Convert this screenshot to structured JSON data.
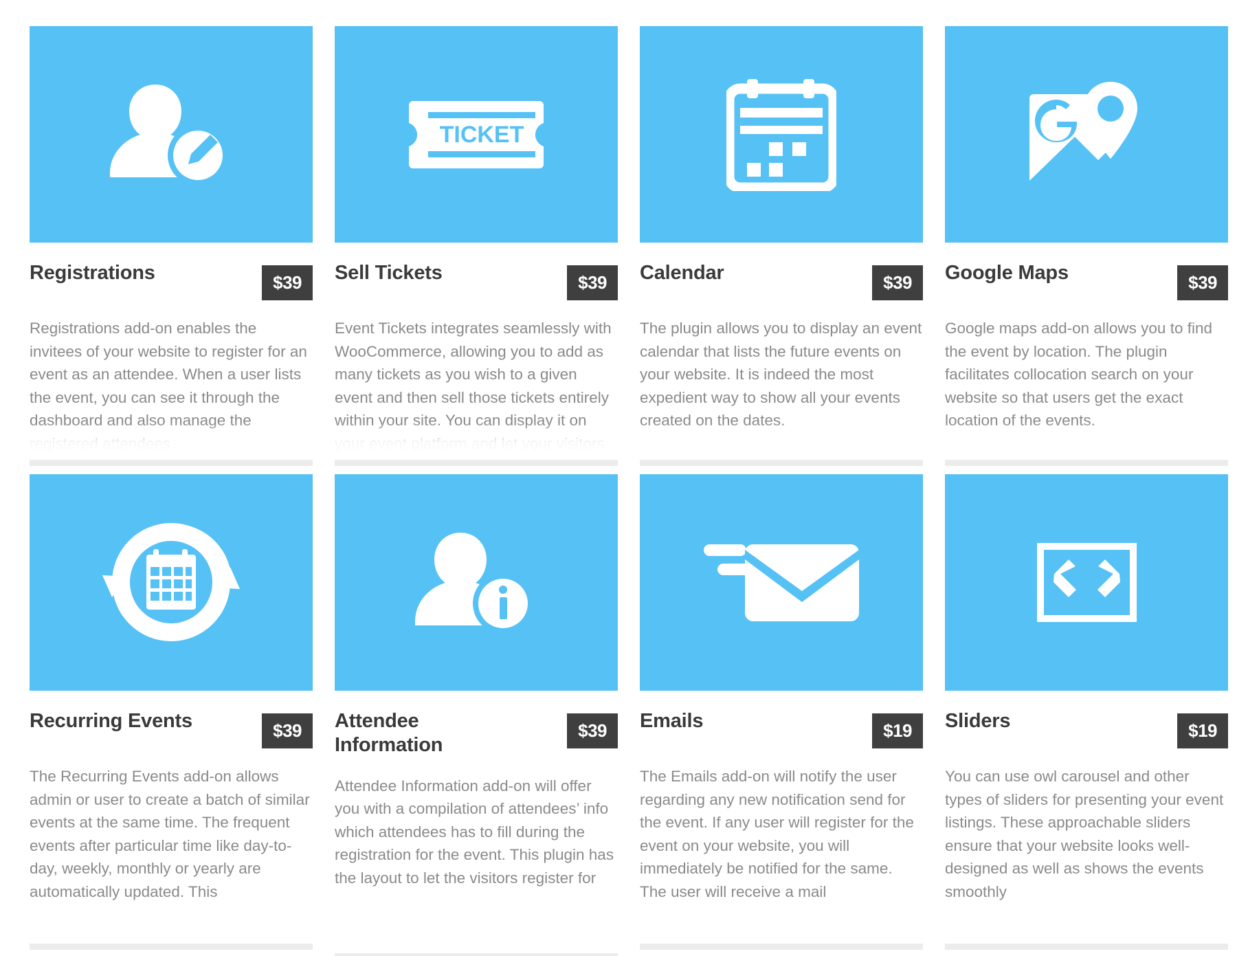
{
  "theme": {
    "accent": "#55c1f5",
    "badge_bg": "#3f3f3f",
    "badge_text": "#ffffff",
    "title_color": "#3a3a3a",
    "body_color": "#8a8a8a",
    "divider_color": "#ececec",
    "page_bg": "#ffffff"
  },
  "layout": {
    "columns": 4,
    "rows": 2
  },
  "cards": [
    {
      "id": "registrations",
      "icon": "user-edit-icon",
      "title": "Registrations",
      "price": "$39",
      "description": "Registrations add-on enables the invitees of your website to register for an event as an attendee. When a user lists the event, you can see it through the dashboard and also manage the registered attendees."
    },
    {
      "id": "sell-tickets",
      "icon": "ticket-icon",
      "icon_label": "TICKET",
      "title": "Sell Tickets",
      "price": "$39",
      "description": "Event Tickets integrates seamlessly with WooCommerce, allowing you to add as many tickets as you wish to a given event and then sell those tickets entirely within your site. You can display it on your event platform and let your visitors"
    },
    {
      "id": "calendar",
      "icon": "calendar-icon",
      "title": "Calendar",
      "price": "$39",
      "description": "The plugin allows you to display an event calendar that lists the future events on your website. It is indeed the most expedient way to show all your events created on the dates."
    },
    {
      "id": "google-maps",
      "icon": "google-maps-icon",
      "title": "Google Maps",
      "price": "$39",
      "description": "Google maps add-on allows you to find the event by location. The plugin facilitates collocation search on your website so that users get the exact location of the events."
    },
    {
      "id": "recurring-events",
      "icon": "recurring-events-icon",
      "title": "Recurring Events",
      "price": "$39",
      "description": "The Recurring Events add-on allows admin or user to create a batch of similar events at the same time. The frequent events after particular time like day-to-day, weekly, monthly or yearly are automatically updated. This"
    },
    {
      "id": "attendee-information",
      "icon": "user-info-icon",
      "title": "Attendee Information",
      "price": "$39",
      "description": "Attendee Information add-on will offer you with a compilation of attendees’ info which attendees has to fill during the registration for the event. This plugin has the layout to let the visitors register for"
    },
    {
      "id": "emails",
      "icon": "email-send-icon",
      "title": "Emails",
      "price": "$19",
      "description": "The Emails add-on will notify the user regarding any new notification send for the event. If any user will register for the event on your website, you will immediately be notified for the same. The user will receive a mail"
    },
    {
      "id": "sliders",
      "icon": "slider-arrows-icon",
      "title": "Sliders",
      "price": "$19",
      "description": "You can use owl carousel and other types of sliders for presenting your event listings. These approachable sliders ensure that your website looks well-designed as well as shows the events smoothly"
    }
  ]
}
